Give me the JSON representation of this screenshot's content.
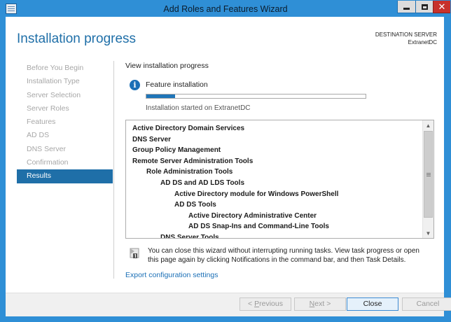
{
  "window": {
    "title": "Add Roles and Features Wizard",
    "close_glyph": "✕"
  },
  "header": {
    "page_title": "Installation progress",
    "destination_label": "DESTINATION SERVER",
    "destination_name": "ExtranetDC"
  },
  "nav": {
    "items": [
      {
        "label": "Before You Begin",
        "active": false
      },
      {
        "label": "Installation Type",
        "active": false
      },
      {
        "label": "Server Selection",
        "active": false
      },
      {
        "label": "Server Roles",
        "active": false
      },
      {
        "label": "Features",
        "active": false
      },
      {
        "label": "AD DS",
        "active": false
      },
      {
        "label": "DNS Server",
        "active": false
      },
      {
        "label": "Confirmation",
        "active": false
      },
      {
        "label": "Results",
        "active": true
      }
    ]
  },
  "main": {
    "view_label": "View installation progress",
    "info_glyph": "i",
    "feature_label": "Feature installation",
    "progress_fraction": 0.13,
    "started_label": "Installation started on ExtranetDC",
    "features": [
      {
        "label": "Active Directory Domain Services",
        "level": 0
      },
      {
        "label": "DNS Server",
        "level": 0
      },
      {
        "label": "Group Policy Management",
        "level": 0
      },
      {
        "label": "Remote Server Administration Tools",
        "level": 0
      },
      {
        "label": "Role Administration Tools",
        "level": 1
      },
      {
        "label": "AD DS and AD LDS Tools",
        "level": 2
      },
      {
        "label": "Active Directory module for Windows PowerShell",
        "level": 3
      },
      {
        "label": "AD DS Tools",
        "level": 3
      },
      {
        "label": "Active Directory Administrative Center",
        "level": 4
      },
      {
        "label": "AD DS Snap-Ins and Command-Line Tools",
        "level": 4
      },
      {
        "label": "DNS Server Tools",
        "level": 2
      }
    ],
    "scroll_up_glyph": "▲",
    "scroll_down_glyph": "▼",
    "note": "You can close this wizard without interrupting running tasks. View task progress or open this page again by clicking Notifications in the command bar, and then Task Details.",
    "export_link": "Export configuration settings"
  },
  "footer": {
    "prev_prefix": "< ",
    "prev_key": "P",
    "prev_rest": "revious",
    "next_key": "N",
    "next_rest": "ext >",
    "close_label": "Close",
    "cancel_label": "Cancel"
  },
  "colors": {
    "accent": "#1f6fa8",
    "title_bar": "#2f8fd6",
    "close_button": "#c7312b"
  }
}
